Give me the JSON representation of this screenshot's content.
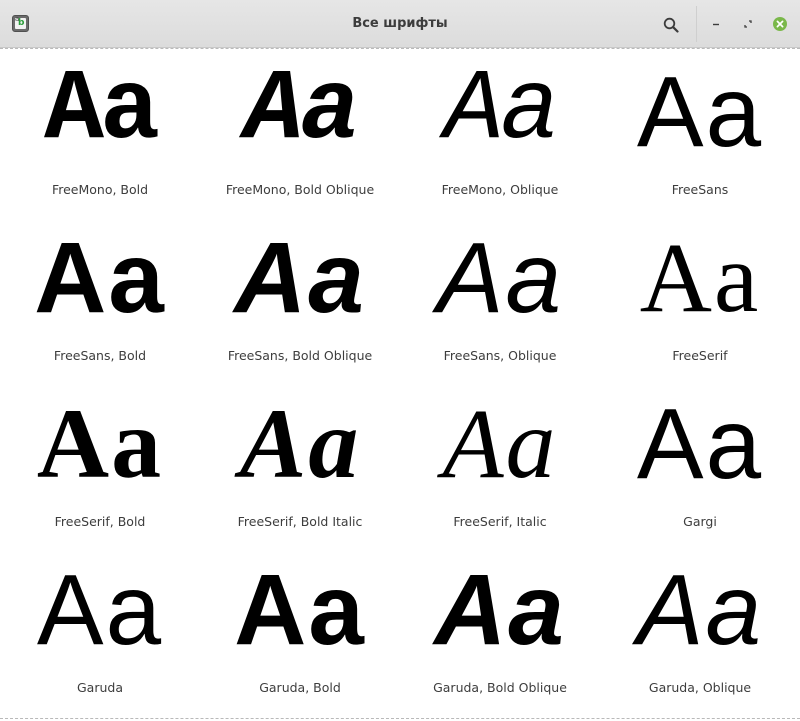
{
  "window": {
    "title": "Все шрифты",
    "app_icon": "font-viewer-icon"
  },
  "headerbar": {
    "search_icon": "search-icon",
    "minimize_icon": "minimize-icon",
    "maximize_icon": "maximize-icon",
    "close_icon": "close-icon",
    "close_color": "#7ab84a"
  },
  "fonts": [
    {
      "sample": "Aa",
      "name": "FreeMono, Bold"
    },
    {
      "sample": "Aa",
      "name": "FreeMono, Bold Oblique"
    },
    {
      "sample": "Aa",
      "name": "FreeMono, Oblique"
    },
    {
      "sample": "Aa",
      "name": "FreeSans"
    },
    {
      "sample": "Aa",
      "name": "FreeSans, Bold"
    },
    {
      "sample": "Aa",
      "name": "FreeSans, Bold Oblique"
    },
    {
      "sample": "Aa",
      "name": "FreeSans, Oblique"
    },
    {
      "sample": "Aa",
      "name": "FreeSerif"
    },
    {
      "sample": "Aa",
      "name": "FreeSerif, Bold"
    },
    {
      "sample": "Aa",
      "name": "FreeSerif, Bold Italic"
    },
    {
      "sample": "Aa",
      "name": "FreeSerif, Italic"
    },
    {
      "sample": "Aa",
      "name": "Gargi"
    },
    {
      "sample": "Aa",
      "name": "Garuda"
    },
    {
      "sample": "Aa",
      "name": "Garuda, Bold"
    },
    {
      "sample": "Aa",
      "name": "Garuda, Bold Oblique"
    },
    {
      "sample": "Aa",
      "name": "Garuda, Oblique"
    }
  ]
}
